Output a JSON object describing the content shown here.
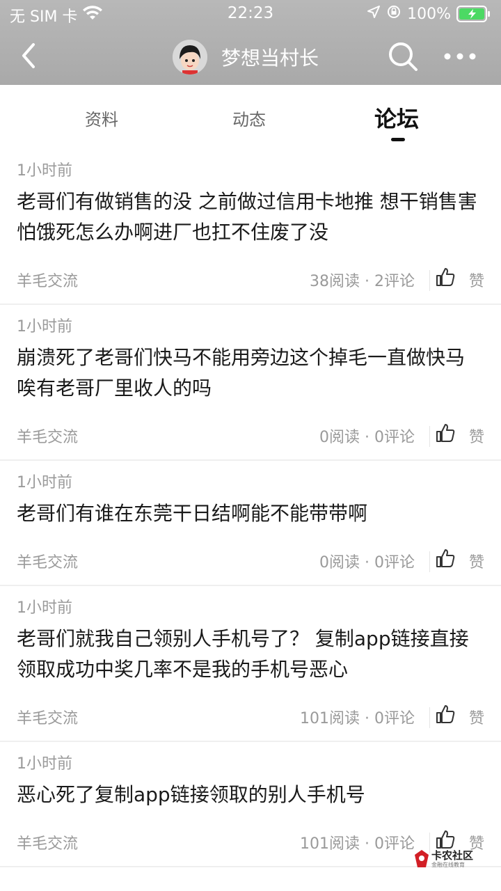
{
  "status_bar": {
    "carrier": "无 SIM 卡",
    "time": "22:23",
    "battery_percent": "100%",
    "wifi_icon": "wifi-icon",
    "location_icon": "location-arrow-icon",
    "lock_icon": "rotation-lock-icon",
    "battery_icon": "battery-charging-icon"
  },
  "nav": {
    "title": "梦想当村长",
    "back_icon": "chevron-left-icon",
    "search_icon": "search-icon",
    "more_icon": "more-dots-icon"
  },
  "tabs": [
    {
      "label": "资料",
      "active": false
    },
    {
      "label": "动态",
      "active": false
    },
    {
      "label": "论坛",
      "active": true
    }
  ],
  "posts": [
    {
      "time": "1小时前",
      "text": "老哥们有做销售的没   之前做过信用卡地推   想干销售害怕饿死怎么办啊进厂也扛不住废了没",
      "source": "羊毛交流",
      "stats": "38阅读 · 2评论",
      "like_label": "赞"
    },
    {
      "time": "1小时前",
      "text": "崩溃死了老哥们快马不能用旁边这个掉毛一直做快马 唉有老哥厂里收人的吗",
      "source": "羊毛交流",
      "stats": "0阅读 · 0评论",
      "like_label": "赞"
    },
    {
      "time": "1小时前",
      "text": "老哥们有谁在东莞干日结啊能不能带带啊",
      "source": "羊毛交流",
      "stats": "0阅读 · 0评论",
      "like_label": "赞"
    },
    {
      "time": "1小时前",
      "text": "老哥们就我自己领别人手机号了？   复制app链接直接领取成功中奖几率不是我的手机号恶心",
      "source": "羊毛交流",
      "stats": "101阅读 · 0评论",
      "like_label": "赞"
    },
    {
      "time": "1小时前",
      "text": "恶心死了复制app链接领取的别人手机号",
      "source": "羊毛交流",
      "stats": "101阅读 · 0评论",
      "like_label": "赞"
    }
  ],
  "watermark": {
    "text": "卡农社区",
    "subtext": "金融在线教育"
  }
}
